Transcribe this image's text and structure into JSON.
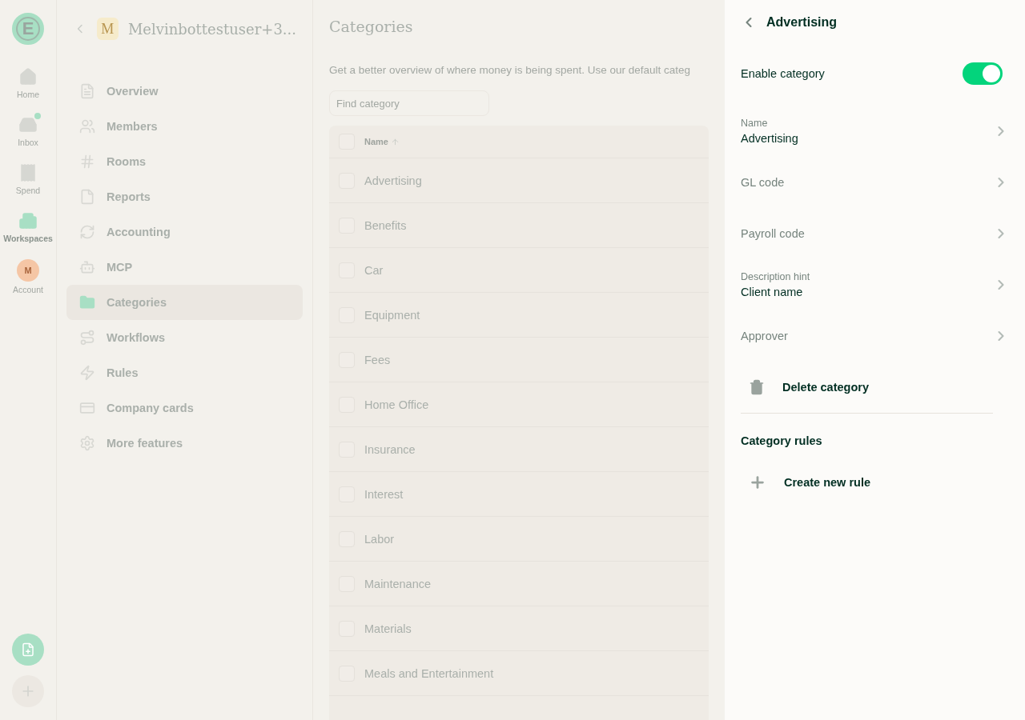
{
  "nav_rail": {
    "logo": "E",
    "items": [
      {
        "label": "Home",
        "selected": false,
        "unread": false
      },
      {
        "label": "Inbox",
        "selected": false,
        "unread": true
      },
      {
        "label": "Spend",
        "selected": false,
        "unread": false
      },
      {
        "label": "Workspaces",
        "selected": true,
        "unread": false
      }
    ],
    "account": {
      "initial": "M",
      "label": "Account"
    }
  },
  "sidebar": {
    "workspace_avatar": "M",
    "workspace_name": "Melvinbottestuser+3...",
    "items": [
      {
        "label": "Overview",
        "selected": false
      },
      {
        "label": "Members",
        "selected": false
      },
      {
        "label": "Rooms",
        "selected": false
      },
      {
        "label": "Reports",
        "selected": false
      },
      {
        "label": "Accounting",
        "selected": false
      },
      {
        "label": "MCP",
        "selected": false
      },
      {
        "label": "Categories",
        "selected": true
      },
      {
        "label": "Workflows",
        "selected": false
      },
      {
        "label": "Rules",
        "selected": false
      },
      {
        "label": "Company cards",
        "selected": false
      },
      {
        "label": "More features",
        "selected": false
      }
    ]
  },
  "main": {
    "title": "Categories",
    "description": "Get a better overview of where money is being spent. Use our default categ",
    "search": {
      "placeholder": "Find category"
    },
    "table": {
      "columns": [
        "Name"
      ],
      "select_all_checked": false,
      "rows": [
        {
          "name": "Advertising",
          "checked": false
        },
        {
          "name": "Benefits",
          "checked": false
        },
        {
          "name": "Car",
          "checked": false
        },
        {
          "name": "Equipment",
          "checked": false
        },
        {
          "name": "Fees",
          "checked": false
        },
        {
          "name": "Home Office",
          "checked": false
        },
        {
          "name": "Insurance",
          "checked": false
        },
        {
          "name": "Interest",
          "checked": false
        },
        {
          "name": "Labor",
          "checked": false
        },
        {
          "name": "Maintenance",
          "checked": false
        },
        {
          "name": "Materials",
          "checked": false
        },
        {
          "name": "Meals and Entertainment",
          "checked": false
        }
      ]
    }
  },
  "panel": {
    "title": "Advertising",
    "toggle": {
      "label": "Enable category",
      "on": true
    },
    "fields": [
      {
        "label": "Name",
        "value": "Advertising"
      },
      {
        "label": "GL code"
      },
      {
        "label": "Payroll code"
      },
      {
        "label": "Description hint",
        "value": "Client name"
      },
      {
        "label": "Approver"
      }
    ],
    "delete_action": "Delete category",
    "rules_title": "Category rules",
    "create_rule": "Create new rule"
  }
}
